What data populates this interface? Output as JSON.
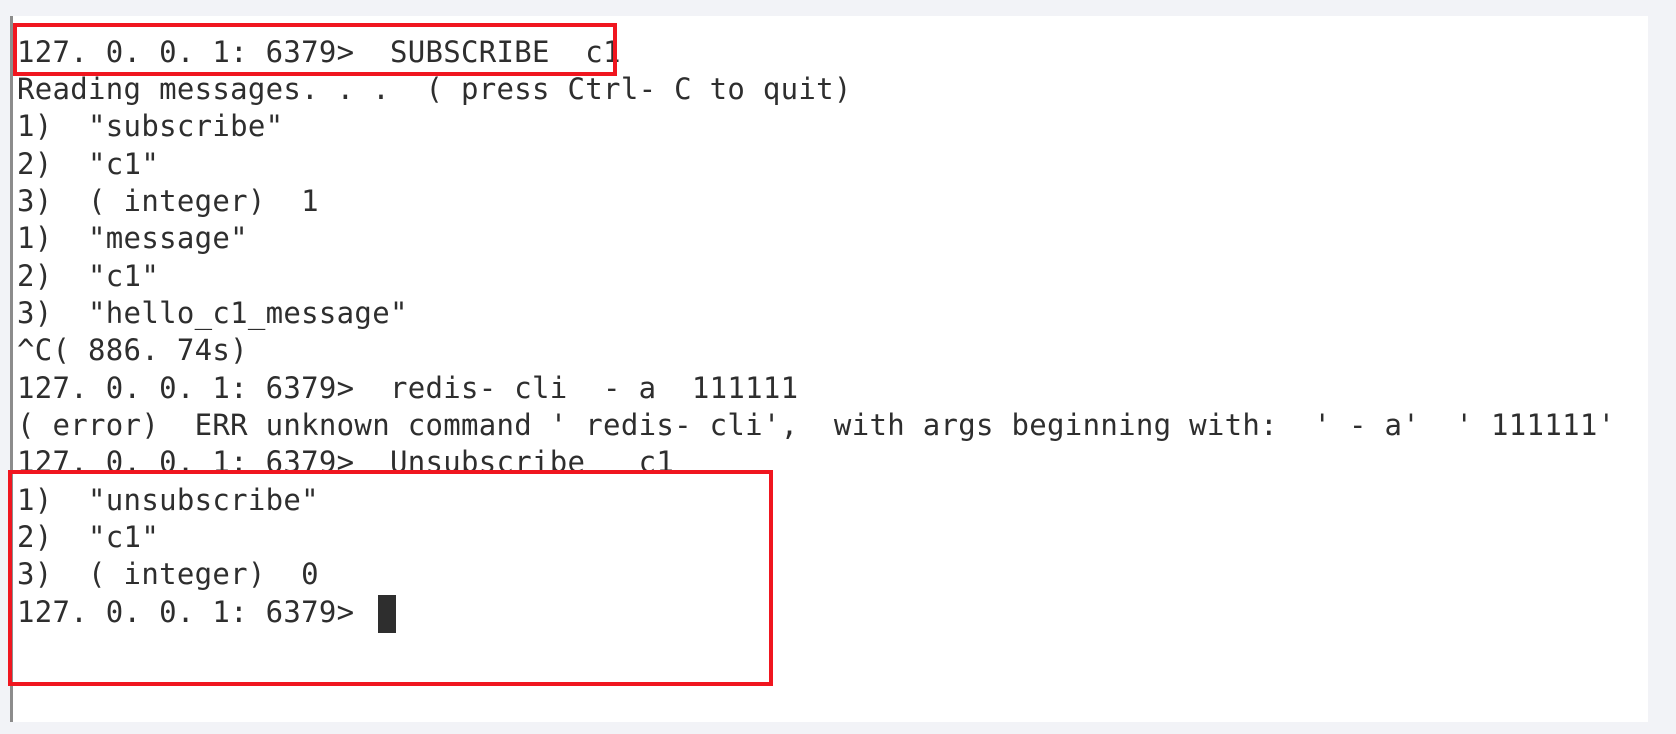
{
  "terminal": {
    "lines": [
      "127. 0. 0. 1: 6379>  SUBSCRIBE  c1",
      "Reading messages. . .  ( press Ctrl- C to quit)",
      "1)  \"subscribe\"",
      "2)  \"c1\"",
      "3)  ( integer)  1",
      "1)  \"message\"",
      "2)  \"c1\"",
      "3)  \"hello_c1_message\"",
      "^C( 886. 74s)",
      "127. 0. 0. 1: 6379>  redis- cli  - a  111111",
      "( error)  ERR unknown command ' redis- cli',  with args beginning with:  ' - a'  ' 111111'",
      "127. 0. 0. 1: 6379>  Unsubscribe   c1",
      "1)  \"unsubscribe\"",
      "2)  \"c1\"",
      "3)  ( integer)  0",
      "127. 0. 0. 1: 6379> "
    ]
  },
  "colors": {
    "highlight": "#f0161f",
    "text": "#2e2e2e",
    "background": "#ffffff"
  }
}
